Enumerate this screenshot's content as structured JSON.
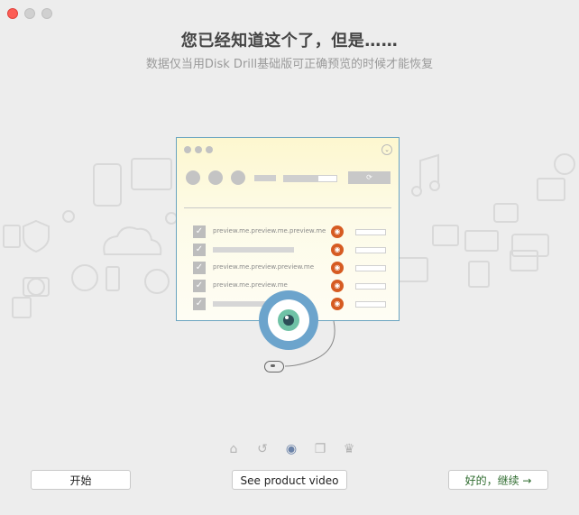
{
  "window": {
    "controls": [
      "close",
      "minimize",
      "maximize"
    ]
  },
  "header": {
    "title": "您已经知道这个了，但是……",
    "subtitle": "数据仅当用Disk Drill基础版可正确预览的时候才能恢复"
  },
  "illustration": {
    "file_rows": [
      {
        "name": "preview.me.preview.me.preview.me",
        "checked": true
      },
      {
        "name": "",
        "checked": true
      },
      {
        "name": "preview.me.preview.preview.me",
        "checked": true
      },
      {
        "name": "preview.me.preview.me",
        "checked": true
      },
      {
        "name": "",
        "checked": true
      }
    ],
    "eye_color": "#d65b22",
    "lens_color": "#6ca4cc",
    "iris_color": "#6fc2a6"
  },
  "pager": {
    "items": [
      {
        "icon": "home-icon",
        "active": false
      },
      {
        "icon": "undo-icon",
        "active": false
      },
      {
        "icon": "eye-icon",
        "active": true
      },
      {
        "icon": "copy-icon",
        "active": false
      },
      {
        "icon": "crown-icon",
        "active": false
      }
    ]
  },
  "buttons": {
    "start": "开始",
    "video": "See product video",
    "next": "好的，继续 →"
  }
}
